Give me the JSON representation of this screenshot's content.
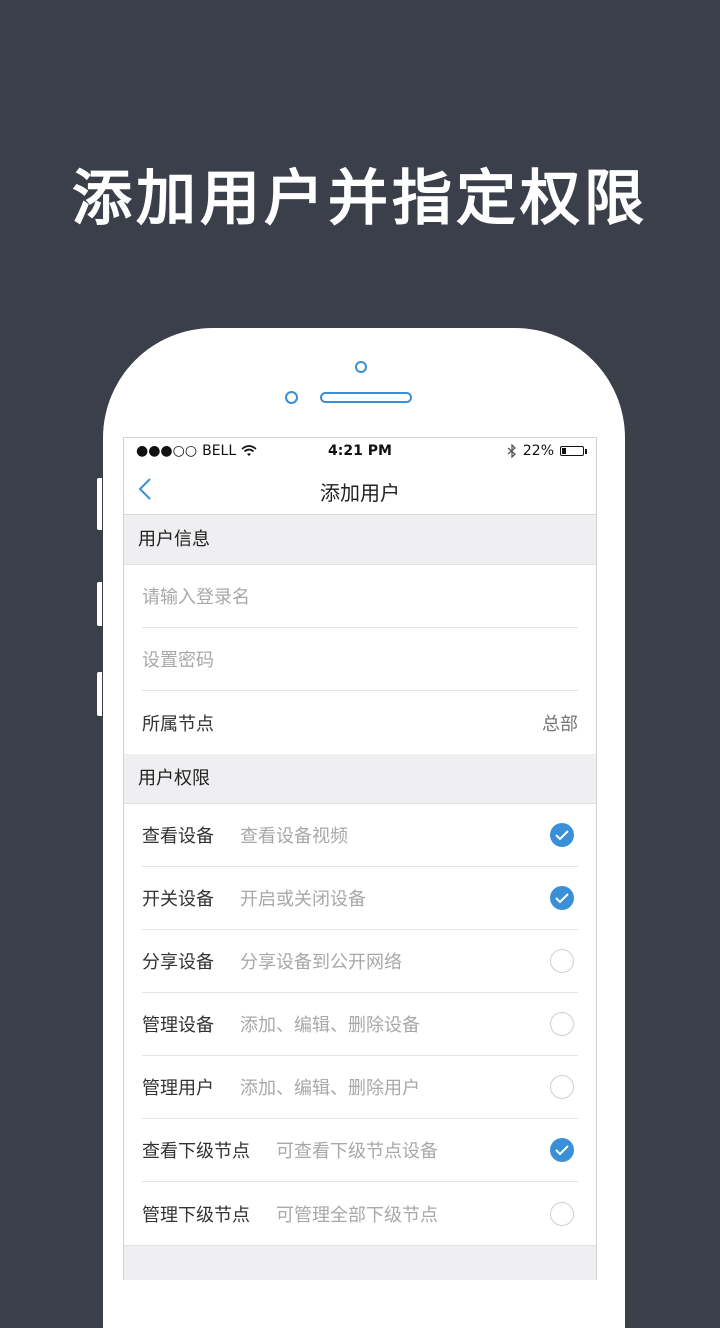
{
  "headline": "添加用户并指定权限",
  "status_bar": {
    "carrier": "BELL",
    "time": "4:21 PM",
    "battery": "22%",
    "battery_level": 0.22
  },
  "nav": {
    "title": "添加用户"
  },
  "user_info": {
    "header": "用户信息",
    "login_placeholder": "请输入登录名",
    "password_placeholder": "设置密码",
    "node_label": "所属节点",
    "node_value": "总部"
  },
  "permissions": {
    "header": "用户权限",
    "items": [
      {
        "name": "查看设备",
        "desc": "查看设备视频",
        "checked": true
      },
      {
        "name": "开关设备",
        "desc": "开启或关闭设备",
        "checked": true
      },
      {
        "name": "分享设备",
        "desc": "分享设备到公开网络",
        "checked": false
      },
      {
        "name": "管理设备",
        "desc": "添加、编辑、删除设备",
        "checked": false
      },
      {
        "name": "管理用户",
        "desc": "添加、编辑、删除用户",
        "checked": false
      },
      {
        "name": "查看下级节点",
        "desc": "可查看下级节点设备",
        "checked": true
      },
      {
        "name": "管理下级节点",
        "desc": "可管理全部下级节点",
        "checked": false
      }
    ]
  },
  "colors": {
    "accent": "#3a90d6",
    "background": "#3b3f4a"
  }
}
